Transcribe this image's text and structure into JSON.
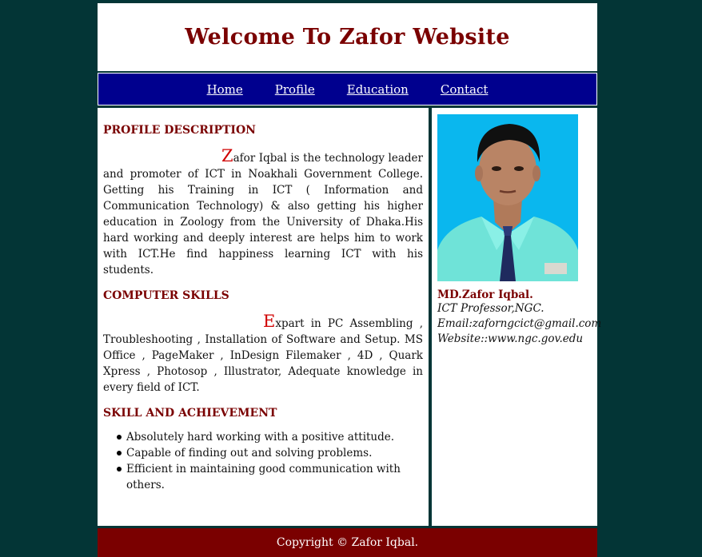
{
  "header": {
    "title": "Welcome To Zafor Website"
  },
  "nav": {
    "items": [
      "Home",
      "Profile",
      "Education",
      "Contact"
    ]
  },
  "main": {
    "profile": {
      "title": "PROFILE DESCRIPTION",
      "drop": "Z",
      "text": "afor Iqbal is the technology leader and promoter of ICT in Noakhali Government College. Getting his Training in ICT ( Information and Communication Technology) & also getting his higher education in Zoology from the University of Dhaka.His hard working and deeply interest are helps him to work with ICT.He find happiness learning ICT with his students."
    },
    "skills": {
      "title": "COMPUTER SKILLS",
      "drop": "E",
      "text": "xpart in PC Assembling , Troubleshooting , Installation of Software and Setup. MS Office , PageMaker , InDesign Filemaker , 4D , Quark Xpress , Photosop , Illustrator, Adequate knowledge in every field of ICT."
    },
    "achievement": {
      "title": "SKILL AND ACHIEVEMENT",
      "items": [
        "Absolutely hard working with a positive attitude.",
        "Capable of finding out and solving problems.",
        "Efficient in maintaining good communication with others."
      ]
    }
  },
  "side": {
    "name": "MD.Zafor Iqbal.",
    "role": "ICT Professor,NGC.",
    "email": "Email:zaforngcict@gmail.com",
    "website": "Website::www.ngc.gov.edu"
  },
  "footer": {
    "copyright": "Copyright © Zafor Iqbal."
  },
  "colors": {
    "background": "#033536",
    "accent": "#7a0000",
    "nav": "#00008e",
    "dropcap": "#d00000"
  }
}
